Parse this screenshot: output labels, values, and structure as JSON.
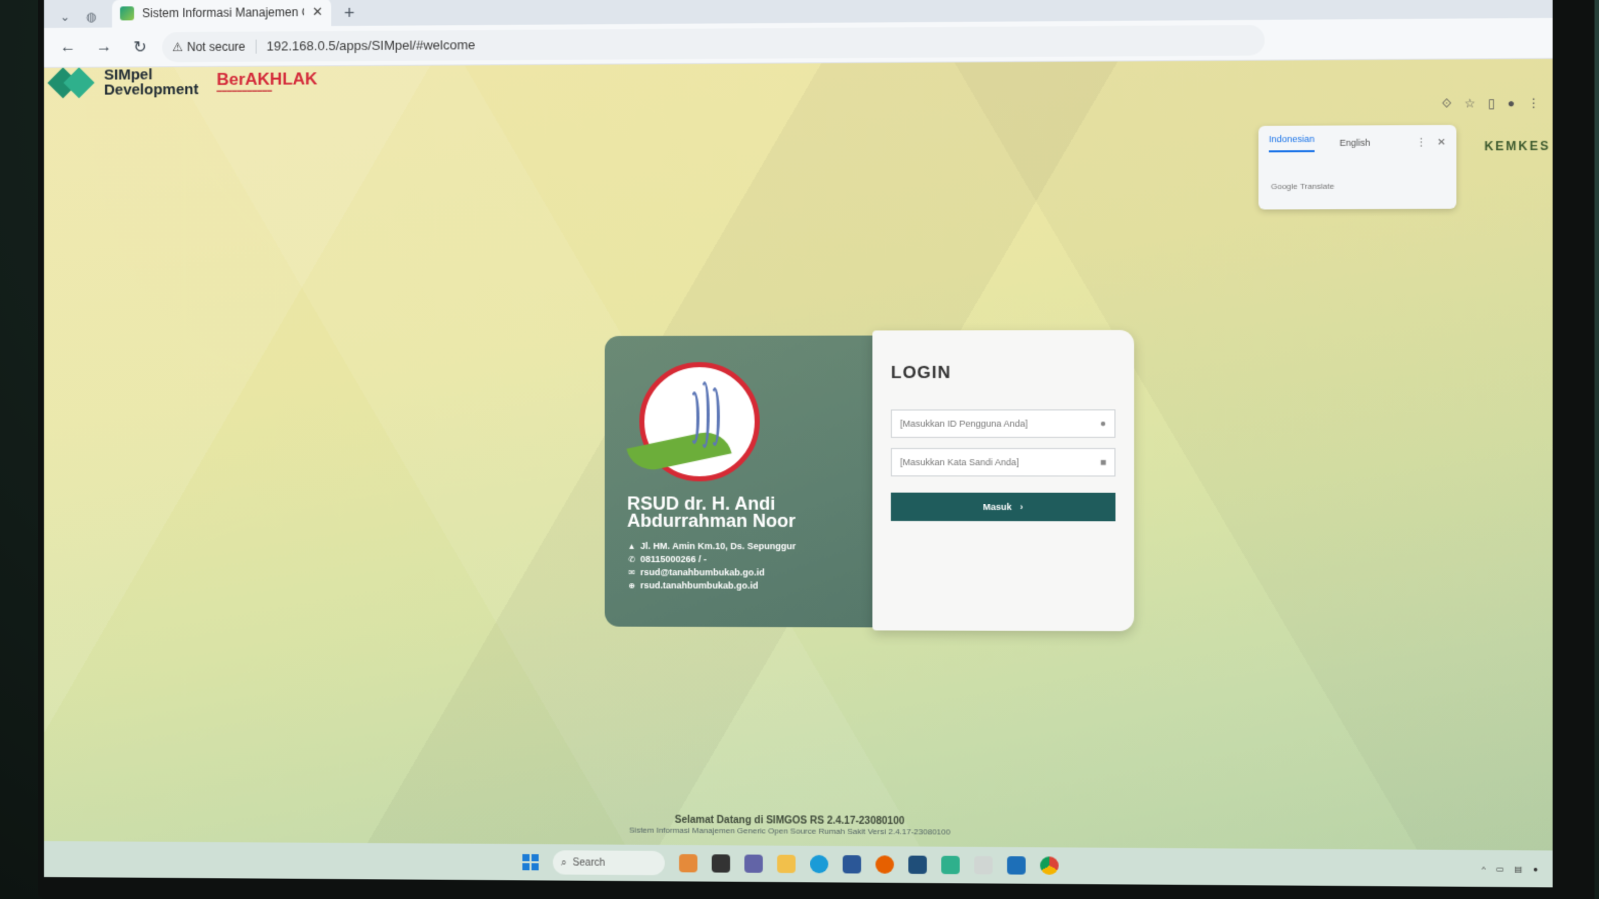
{
  "browser": {
    "tab_title": "Sistem Informasi Manajemen G",
    "security_label": "Not secure",
    "url": "192.168.0.5/apps/SIMpel/#welcome"
  },
  "header": {
    "brand_line1": "SIMpel",
    "brand_line2": "Development",
    "berakhlak": "BerAKHLAK"
  },
  "translate_popup": {
    "tab_active": "Indonesian",
    "tab_other": "English",
    "footer": "Google Translate"
  },
  "kemkes": "KEMKES",
  "hospital": {
    "name": "RSUD dr. H. Andi Abdurrahman Noor",
    "address": "Jl. HM. Amin Km.10, Ds. Sepunggur",
    "phone": "08115000266 / -",
    "email": "rsud@tanahbumbukab.go.id",
    "website": "rsud.tanahbumbukab.go.id"
  },
  "login": {
    "title": "LOGIN",
    "username_placeholder": "[Masukkan ID Pengguna Anda]",
    "password_placeholder": "[Masukkan Kata Sandi Anda]",
    "submit_label": "Masuk"
  },
  "footer": {
    "welcome": "Selamat Datang di SIMGOS RS 2.4.17-23080100",
    "subtitle": "Sistem Informasi Manajemen Generic Open Source Rumah Sakit Versi 2.4.17-23080100"
  },
  "taskbar": {
    "search_placeholder": "Search"
  }
}
